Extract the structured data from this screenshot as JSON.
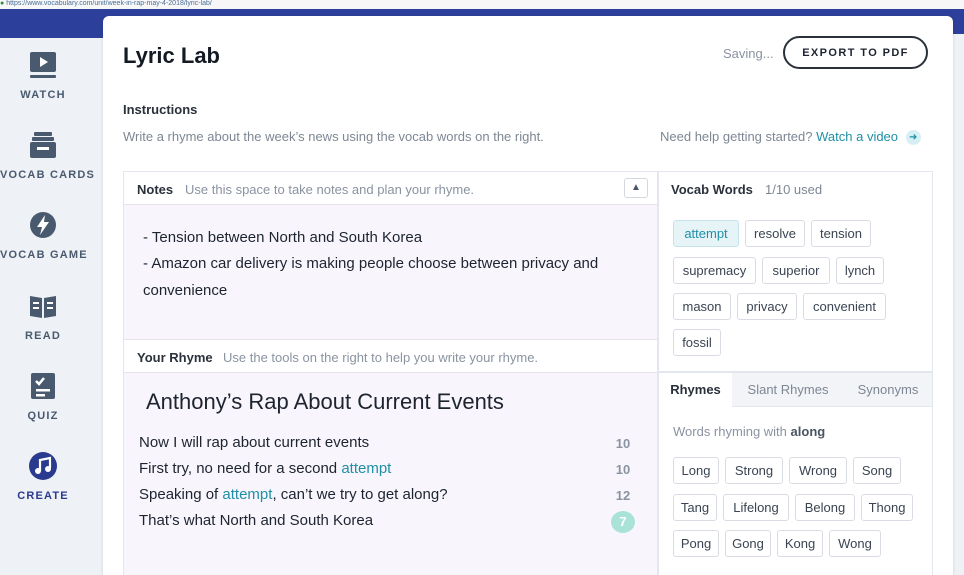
{
  "browser": {
    "url": "https://www.vocabulary.com/unit/week-in-rap-may-4-2018/lyric-lab/"
  },
  "sidebar": {
    "items": [
      {
        "label": "WATCH",
        "icon": "play-video-icon"
      },
      {
        "label": "VOCAB CARDS",
        "icon": "card-stack-icon"
      },
      {
        "label": "VOCAB GAME",
        "icon": "lightning-icon"
      },
      {
        "label": "READ",
        "icon": "open-book-icon"
      },
      {
        "label": "QUIZ",
        "icon": "checklist-icon"
      },
      {
        "label": "CREATE",
        "icon": "music-note-icon"
      }
    ],
    "active": "CREATE",
    "active_color": "#2a3a8f"
  },
  "header": {
    "title": "Lyric Lab",
    "saving": "Saving...",
    "export_label": "EXPORT TO PDF"
  },
  "instructions": {
    "heading": "Instructions",
    "text": "Write a rhyme about the week’s news using the vocab words on the right.",
    "help_prefix": "Need help getting started?",
    "help_link": "Watch a video"
  },
  "notes": {
    "title": "Notes",
    "hint": "Use this space to take notes and plan your rhyme.",
    "lines": [
      "- Tension between North and South Korea",
      "- Amazon car delivery is making people choose between privacy and",
      "convenience"
    ]
  },
  "rhyme": {
    "title": "Your Rhyme",
    "hint": "Use the tools on the right to help you write your rhyme.",
    "rap_title": "Anthony’s Rap About Current Events",
    "lines": [
      {
        "before": "Now I will rap about current events",
        "vocab": "",
        "after": "",
        "syllables": "10"
      },
      {
        "before": "First try, no need for a second ",
        "vocab": "attempt",
        "after": "",
        "syllables": "10"
      },
      {
        "before": "Speaking of ",
        "vocab": "attempt",
        "after": ", can’t we try to get along?",
        "syllables": "12"
      },
      {
        "before": "That’s what North and South Korea",
        "vocab": "",
        "after": "",
        "syllables": "7"
      }
    ]
  },
  "vocab": {
    "title": "Vocab Words",
    "count": "1/10 used",
    "words": [
      "attempt",
      "resolve",
      "tension",
      "supremacy",
      "superior",
      "lynch",
      "mason",
      "privacy",
      "convenient",
      "fossil"
    ],
    "used": [
      "attempt"
    ],
    "used_color": "#1f8fa6"
  },
  "tools": {
    "tabs": [
      "Rhymes",
      "Slant Rhymes",
      "Synonyms"
    ],
    "active_tab": "Rhymes",
    "rhyming_prefix": "Words rhyming with",
    "rhyming_word": "along",
    "results": [
      "Long",
      "Strong",
      "Wrong",
      "Song",
      "Tang",
      "Lifelong",
      "Belong",
      "Thong",
      "Pong",
      "Gong",
      "Kong",
      "Wong"
    ]
  }
}
